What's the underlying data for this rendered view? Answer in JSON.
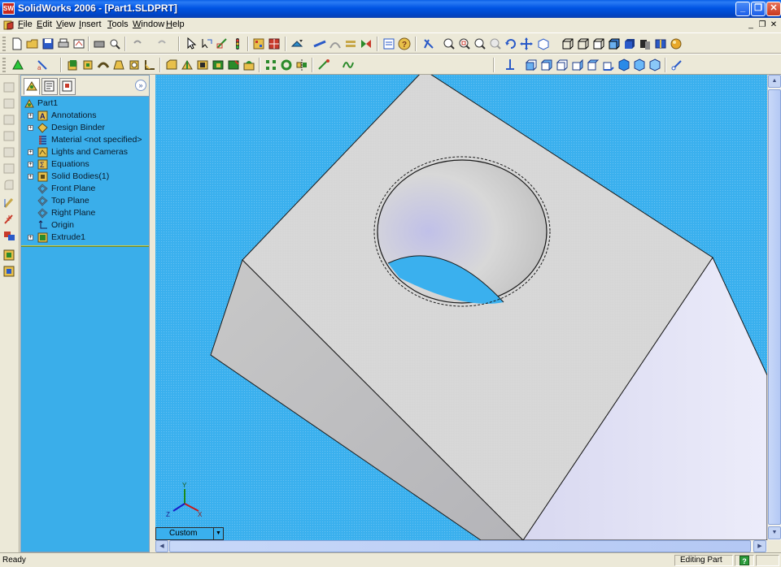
{
  "window": {
    "title": "SolidWorks 2006 - [Part1.SLDPRT]",
    "app_icon_text": "SW"
  },
  "menu": {
    "items": [
      {
        "label": "File",
        "hotkey": "F",
        "rest": "ile"
      },
      {
        "label": "Edit",
        "hotkey": "E",
        "rest": "dit"
      },
      {
        "label": "View",
        "hotkey": "V",
        "rest": "iew"
      },
      {
        "label": "Insert",
        "hotkey": "I",
        "rest": "nsert"
      },
      {
        "label": "Tools",
        "hotkey": "T",
        "rest": "ools"
      },
      {
        "label": "Window",
        "hotkey": "W",
        "rest": "indow"
      },
      {
        "label": "Help",
        "hotkey": "H",
        "rest": "elp"
      }
    ]
  },
  "feature_tree": {
    "collapse_glyph": "»",
    "items": [
      {
        "label": "Part1",
        "icon": "part-icon",
        "expander": ""
      },
      {
        "label": "Annotations",
        "icon": "annotations-icon",
        "expander": "+"
      },
      {
        "label": "Design Binder",
        "icon": "design-binder-icon",
        "expander": "+"
      },
      {
        "label": "Material <not specified>",
        "icon": "material-icon",
        "expander": ""
      },
      {
        "label": "Lights and Cameras",
        "icon": "lights-icon",
        "expander": "+"
      },
      {
        "label": "Equations",
        "icon": "equations-icon",
        "expander": "+"
      },
      {
        "label": "Solid Bodies(1)",
        "icon": "solid-bodies-icon",
        "expander": "+"
      },
      {
        "label": "Front Plane",
        "icon": "plane-icon",
        "expander": ""
      },
      {
        "label": "Top Plane",
        "icon": "plane-icon",
        "expander": ""
      },
      {
        "label": "Right Plane",
        "icon": "plane-icon",
        "expander": ""
      },
      {
        "label": "Origin",
        "icon": "origin-icon",
        "expander": ""
      },
      {
        "label": "Extrude1",
        "icon": "extrude-icon",
        "expander": "+"
      }
    ]
  },
  "graphics": {
    "view_orientation": "Custom",
    "triad": {
      "x": "X",
      "y": "Y",
      "z": "Z"
    },
    "background_color": "#3ab0ee"
  },
  "status": {
    "left": "Ready",
    "mode": "Editing Part",
    "help_glyph": "?"
  }
}
